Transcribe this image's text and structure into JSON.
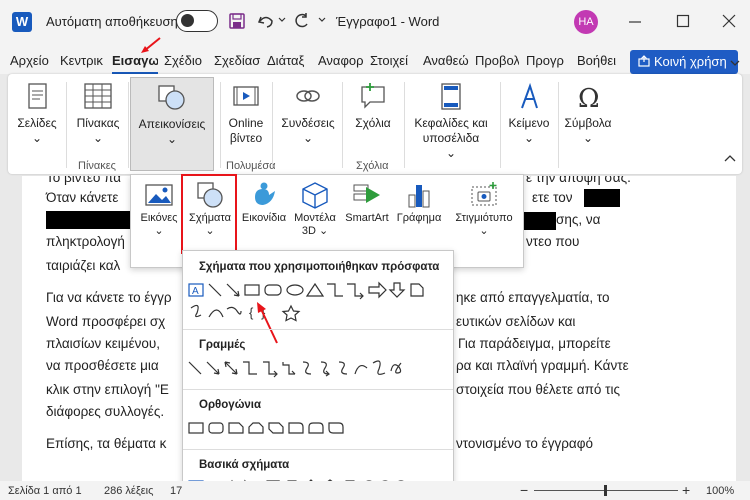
{
  "titlebar": {
    "app_logo": "W",
    "autosave_label": "Αυτόματη αποθήκευση",
    "doc_title": "Έγγραφο1  -  Word",
    "avatar_initials": "HA"
  },
  "tabs": [
    "Αρχείο",
    "Κεντρικ",
    "Εισαγω",
    "Σχέδιο",
    "Σχεδίασ",
    "Διάταξ",
    "Αναφορ",
    "Στοιχεί",
    "Αναθεώ",
    "Προβολ",
    "Προγρ",
    "Βοήθει"
  ],
  "share_label": "Κοινή χρήση",
  "ribbon": {
    "pages": "Σελίδες",
    "table": "Πίνακας",
    "tables_group": "Πίνακες",
    "illustrations": "Απεικονίσεις",
    "online_video": [
      "Online",
      "βίντεο"
    ],
    "media_group": "Πολυμέσα",
    "links": "Συνδέσεις",
    "comments": "Σχόλια",
    "comments_group": "Σχόλια",
    "header_footer": [
      "Κεφαλίδες και",
      "υποσέλιδα"
    ],
    "text": "Κείμενο",
    "symbols": "Σύμβολα"
  },
  "pics_panel": {
    "pictures": "Εικόνες",
    "shapes": "Σχήματα",
    "icons": "Εικονίδια",
    "models3d": [
      "Μοντέλα",
      "3D"
    ],
    "smartart": "SmartArt",
    "chart": "Γράφημα",
    "screenshot": "Στιγμιότυπο"
  },
  "shapes_panel": {
    "recent": "Σχήματα που χρησιμοποιήθηκαν πρόσφατα",
    "lines": "Γραμμές",
    "rectangles": "Ορθογώνια",
    "basic": "Βασικά σχήματα"
  },
  "document": {
    "lines": [
      "Το βίντεο πα",
      "Όταν κάνετε",
      "πληκτρολογή",
      "ταιριάζει καλ",
      "Για να κάνετε το έγγρ",
      "Word προσφέρει σχ",
      "πλαισίων κειμένου,",
      "να προσθέσετε μια",
      "κλικ στην επιλογή \"Ε",
      "διάφορες συλλογές.",
      "Επίσης, τα θέματα κ"
    ],
    "right_fragments": [
      "ε την άποψή σας.",
      "ετε τον",
      "σης, να",
      "ντεο που",
      "ηκε από επαγγελματία, το",
      "ευτικών σελίδων και",
      "Για παράδειγμα, μπορείτε",
      "ρα και πλαϊνή γραμμή. Κάντε",
      "στοιχεία που θέλετε από τις",
      "ντονισμένο το έγγραφό"
    ]
  },
  "status": {
    "page": "Σελίδα 1 από 1",
    "words": "286 λέξεις",
    "truncated": "17",
    "zoom": "100%"
  },
  "colors": {
    "accent": "#185abd",
    "share": "#1f5cc4",
    "highlight": "#e8141a",
    "avatar": "#c239b3"
  }
}
